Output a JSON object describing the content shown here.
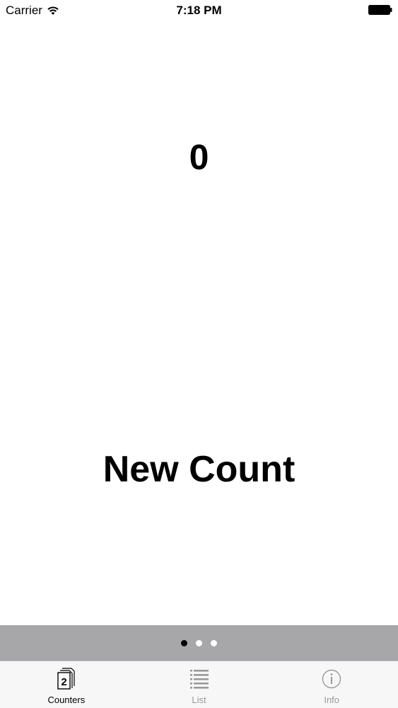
{
  "status_bar": {
    "carrier": "Carrier",
    "time": "7:18 PM"
  },
  "counter": {
    "value": "0",
    "new_count_label": "New Count"
  },
  "page_indicator": {
    "page_count": 3,
    "active_index": 0
  },
  "tabs": [
    {
      "label": "Counters",
      "icon": "counters-icon",
      "badge": "2",
      "selected": true
    },
    {
      "label": "List",
      "icon": "list-icon",
      "selected": false
    },
    {
      "label": "Info",
      "icon": "info-icon",
      "selected": false
    }
  ],
  "colors": {
    "page_indicator_background": "#a7a7aa",
    "tab_bar_background": "#f7f7f7",
    "tab_inactive": "#9a9a9a",
    "tab_active": "#000000"
  }
}
